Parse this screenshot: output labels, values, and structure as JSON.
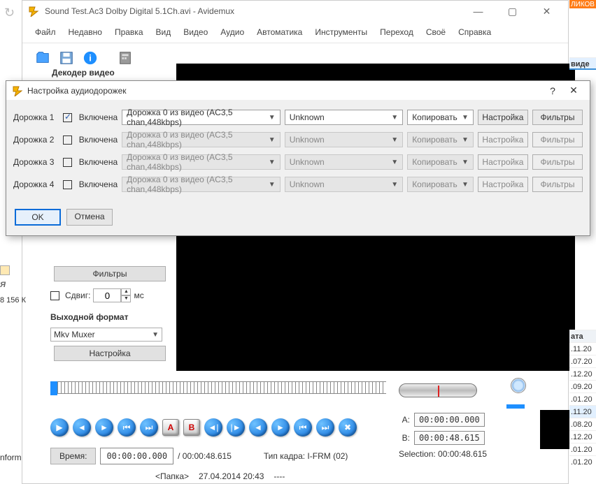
{
  "main": {
    "title": "Sound Test.Ac3 Dolby Digital 5.1Ch.avi - Avidemux",
    "menu": [
      "Файл",
      "Недавно",
      "Правка",
      "Вид",
      "Видео",
      "Аудио",
      "Автоматика",
      "Инструменты",
      "Переход",
      "Своё",
      "Справка"
    ],
    "decoder_label": "Декодер видео",
    "filters_btn": "Фильтры",
    "shift_label": "Сдвиг:",
    "shift_value": "0",
    "shift_unit": "мс",
    "output_format_label": "Выходной формат",
    "muxer": "Mkv Muxer",
    "configure_btn": "Настройка",
    "time_btn_label": "Время:",
    "time_value": "00:00:00.000",
    "duration": "/ 00:00:48.615",
    "frame_type": "Тип кадра:  I-FRM (02)",
    "sel_a_label": "A:",
    "sel_a_value": "00:00:00.000",
    "sel_b_label": "B:",
    "sel_b_value": "00:00:48.615",
    "selection_label": "Selection: 00:00:48.615",
    "status_folder": "<Папка>",
    "status_date": "27.04.2014 20:43",
    "status_dash": "----"
  },
  "left": {
    "small_icon1": "Я",
    "bitrate": "8 156 К",
    "info_label": "nform"
  },
  "right": {
    "orange": "ЛИКОВ",
    "header": "виде",
    "col_header": "ата",
    "dates": [
      ".11.20",
      ".07.20",
      ".12.20",
      ".09.20",
      ".01.20",
      ".11.20",
      ".08.20",
      ".12.20",
      ".01.20",
      ".01.20"
    ]
  },
  "dialog": {
    "title": "Настройка аудиодорожек",
    "help": "?",
    "close": "✕",
    "tracks": [
      {
        "label": "Дорожка 1",
        "enabled": true,
        "enabled_text": "Включена",
        "source": "Дорожка 0 из видео (AC3,5 chan,448kbps)",
        "lang": "Unknown",
        "codec": "Копировать",
        "cfg": "Настройка",
        "flt": "Фильтры"
      },
      {
        "label": "Дорожка 2",
        "enabled": false,
        "enabled_text": "Включена",
        "source": "Дорожка 0 из видео (AC3,5 chan,448kbps)",
        "lang": "Unknown",
        "codec": "Копировать",
        "cfg": "Настройка",
        "flt": "Фильтры"
      },
      {
        "label": "Дорожка 3",
        "enabled": false,
        "enabled_text": "Включена",
        "source": "Дорожка 0 из видео (AC3,5 chan,448kbps)",
        "lang": "Unknown",
        "codec": "Копировать",
        "cfg": "Настройка",
        "flt": "Фильтры"
      },
      {
        "label": "Дорожка 4",
        "enabled": false,
        "enabled_text": "Включена",
        "source": "Дорожка 0 из видео (AC3,5 chan,448kbps)",
        "lang": "Unknown",
        "codec": "Копировать",
        "cfg": "Настройка",
        "flt": "Фильтры"
      }
    ],
    "ok": "OK",
    "cancel": "Отмена"
  }
}
